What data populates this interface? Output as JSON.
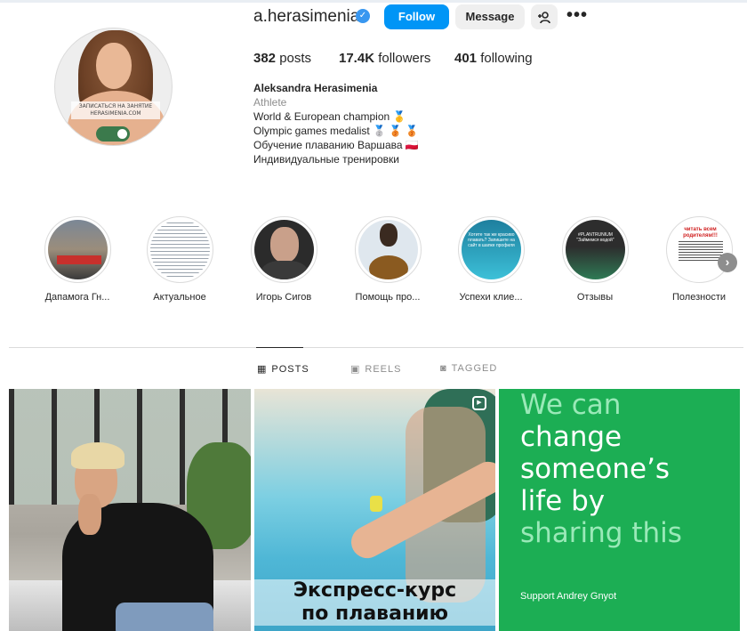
{
  "profile": {
    "username": "a.herasimenia",
    "verified_icon": "verified-badge-icon",
    "avatar_text": "ЗАПИСАТЬСЯ НА ЗАНЯТИЕ\nHERASIMENIA.COM",
    "follow_label": "Follow",
    "message_label": "Message",
    "add_user_icon": "add-user-icon",
    "more_icon": "more-options-icon",
    "full_name": "Aleksandra Herasimenia",
    "category": "Athlete",
    "bio": [
      "World & European champion 🥇",
      "Olympic games medalist 🥈 🥉 🥉",
      "Обучение плаванию Варшава 🇵🇱",
      "Индивидуальные тренировки"
    ]
  },
  "stats": {
    "posts_count": "382",
    "posts_label": "posts",
    "followers_count": "17.4K",
    "followers_label": "followers",
    "following_count": "401",
    "following_label": "following"
  },
  "highlights": [
    {
      "label": "Дапамога Гн..."
    },
    {
      "label": "Актуальное"
    },
    {
      "label": "Игорь Сигов"
    },
    {
      "label": "Помощь про..."
    },
    {
      "label": "Успехи клие..."
    },
    {
      "label": "Отзывы"
    },
    {
      "label": "Полезности"
    }
  ],
  "highlight_texts": {
    "h5": "Хотите так же красиво плавать? Запишите на сайт в шапке профиля",
    "h6": "#PLANTRUNIUM \"Займемся водой\"",
    "h7": "читать всем родителям!!!"
  },
  "tabs": [
    {
      "label": "POSTS",
      "icon": "grid-icon",
      "active": true
    },
    {
      "label": "REELS",
      "icon": "reels-icon",
      "active": false
    },
    {
      "label": "TAGGED",
      "icon": "tagged-icon",
      "active": false
    }
  ],
  "posts": {
    "post2_text_line1": "Экспресс-курс",
    "post2_text_line2": "по плаванию",
    "post3_lines": [
      "We can",
      "change",
      "someone’s",
      "life by",
      "sharing this"
    ],
    "post3_support": "Support Andrey Gnyot"
  },
  "colors": {
    "accent": "#0095f6",
    "post3_bg": "#1cae54",
    "post3_highlight": "#9ae9b8"
  }
}
